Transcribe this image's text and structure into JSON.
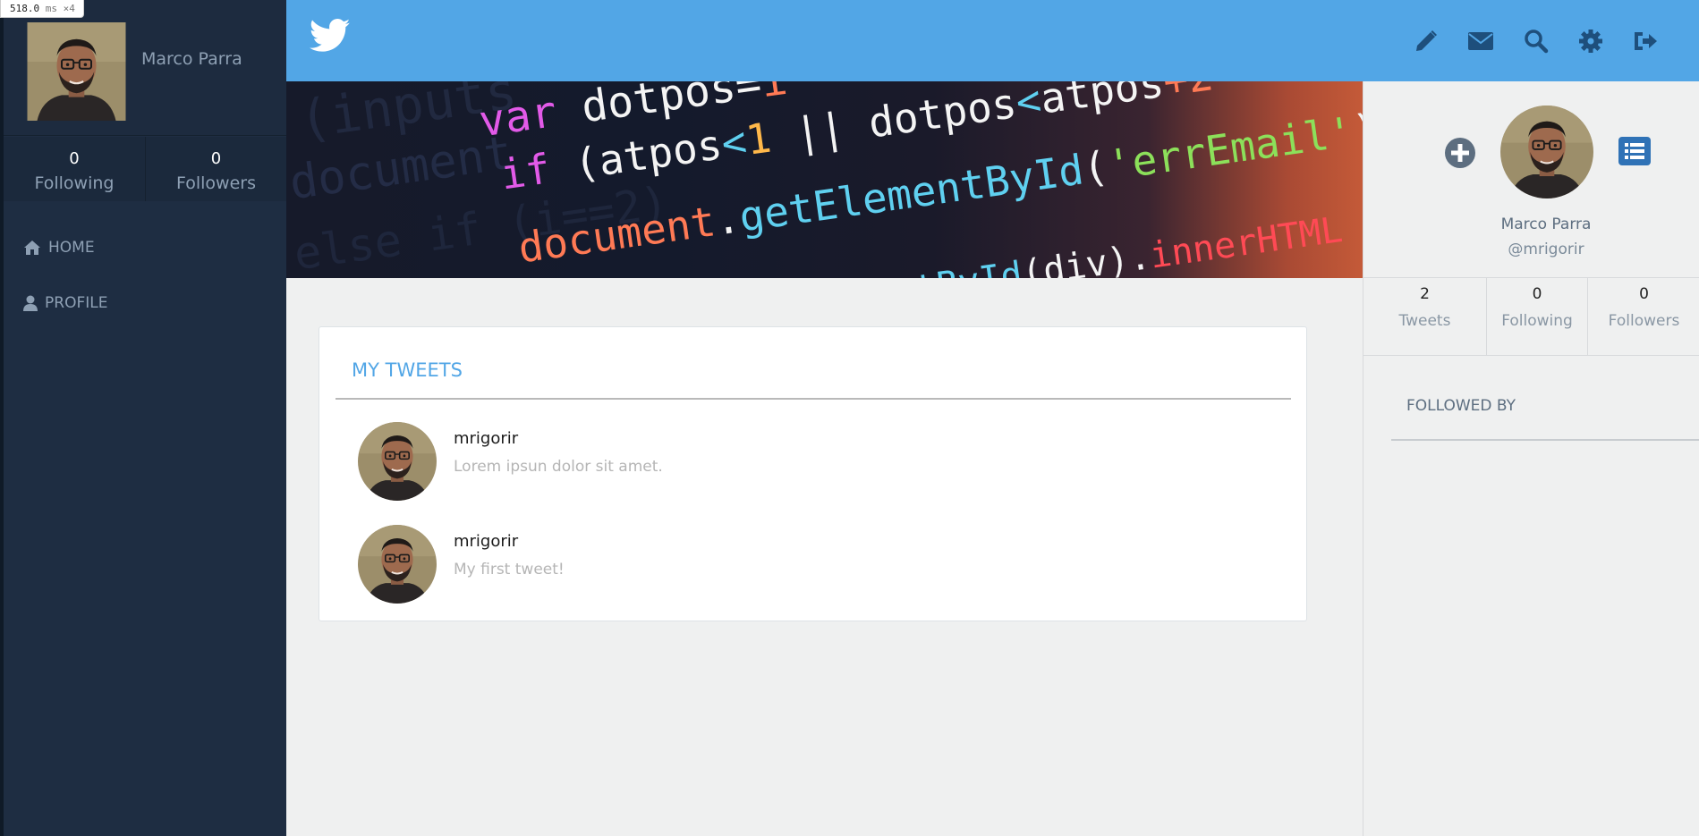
{
  "debug": {
    "time": "518.0",
    "unit": "ms",
    "multiplier": "×4"
  },
  "sidebar": {
    "user_name": "Marco Parra",
    "stats": [
      {
        "count": "0",
        "label": "Following"
      },
      {
        "count": "0",
        "label": "Followers"
      }
    ],
    "nav": [
      {
        "label": "HOME",
        "icon": "home-icon"
      },
      {
        "label": "PROFILE",
        "icon": "user-icon"
      }
    ]
  },
  "topbar": {
    "logo": "twitter-bird-icon",
    "actions": [
      "pencil-icon",
      "envelope-icon",
      "search-icon",
      "gear-icon",
      "sign-out-icon"
    ]
  },
  "feed": {
    "title": "MY TWEETS",
    "tweets": [
      {
        "user": "mrigorir",
        "text": "Lorem ipsun dolor sit amet."
      },
      {
        "user": "mrigorir",
        "text": "My first tweet!"
      }
    ]
  },
  "profile_panel": {
    "name": "Marco Parra",
    "handle": "@mrigorir",
    "stats": [
      {
        "count": "2",
        "label": "Tweets"
      },
      {
        "count": "0",
        "label": "Following"
      },
      {
        "count": "0",
        "label": "Followers"
      }
    ],
    "followed_by_title": "FOLLOWED BY"
  },
  "colors": {
    "accent_blue": "#52a6e6",
    "sidebar_bg": "#1e2d42",
    "muted_text": "#8ea0b4"
  }
}
